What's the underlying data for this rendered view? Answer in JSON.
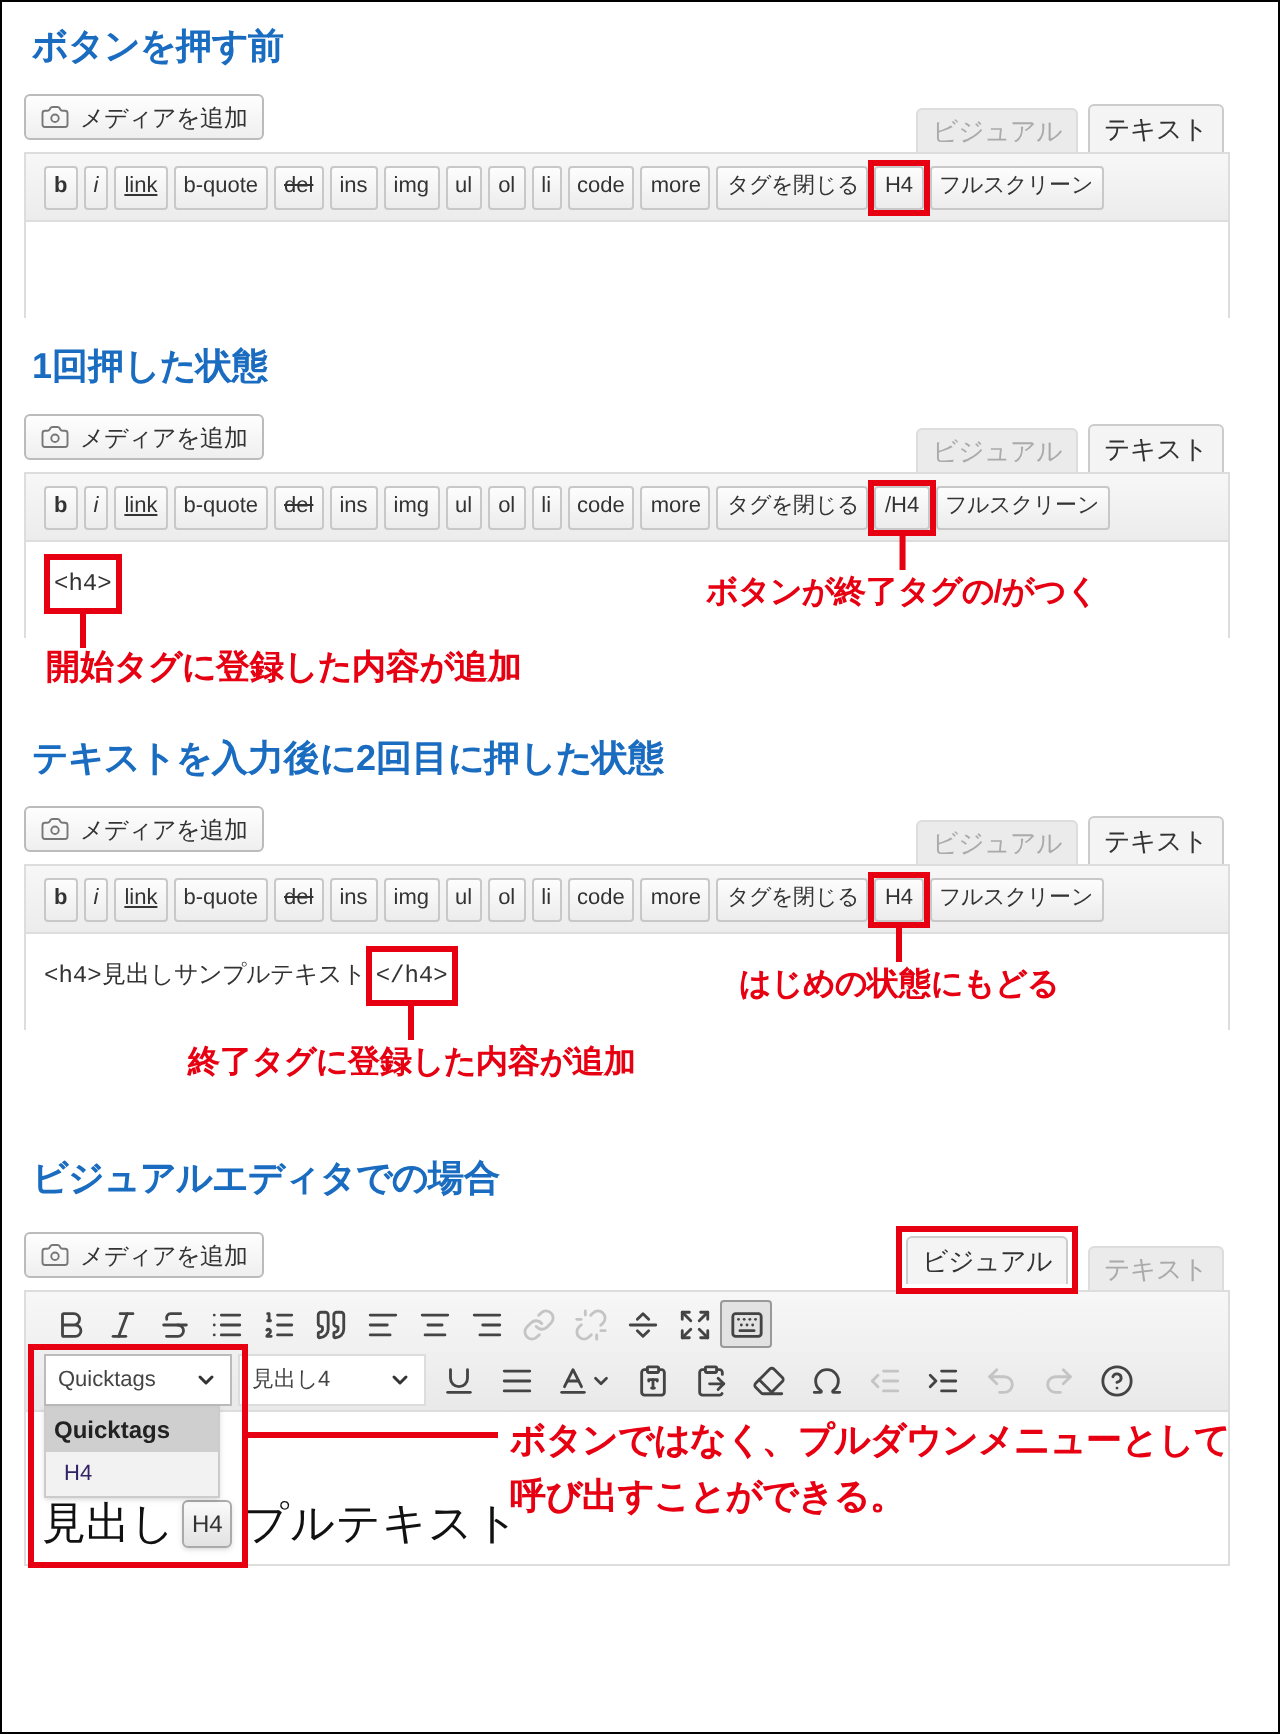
{
  "sections": [
    {
      "kind": "text_editor",
      "heading": "ボタンを押す前",
      "media_button": "メディアを追加",
      "tabs": [
        {
          "label": "ビジュアル",
          "selected": false,
          "highlighted": false
        },
        {
          "label": "テキスト",
          "selected": true,
          "highlighted": false
        }
      ],
      "quicktags": [
        {
          "label": "b",
          "kind": "bold",
          "highlighted": false
        },
        {
          "label": "i",
          "kind": "italic",
          "highlighted": false
        },
        {
          "label": "link",
          "kind": "underline",
          "highlighted": false
        },
        {
          "label": "b-quote",
          "kind": "plain",
          "highlighted": false
        },
        {
          "label": "del",
          "kind": "strike",
          "highlighted": false
        },
        {
          "label": "ins",
          "kind": "plain",
          "highlighted": false
        },
        {
          "label": "img",
          "kind": "plain",
          "highlighted": false
        },
        {
          "label": "ul",
          "kind": "plain",
          "highlighted": false
        },
        {
          "label": "ol",
          "kind": "plain",
          "highlighted": false
        },
        {
          "label": "li",
          "kind": "plain",
          "highlighted": false
        },
        {
          "label": "code",
          "kind": "plain",
          "highlighted": false
        },
        {
          "label": "more",
          "kind": "plain",
          "highlighted": false
        },
        {
          "label": "タグを閉じる",
          "kind": "plain",
          "highlighted": false
        },
        {
          "label": "H4",
          "kind": "plain",
          "highlighted": true
        },
        {
          "label": "フルスクリーン",
          "kind": "plain",
          "highlighted": false
        }
      ]
    },
    {
      "kind": "text_editor",
      "heading": "1回押した状態",
      "media_button": "メディアを追加",
      "tabs": [
        {
          "label": "ビジュアル",
          "selected": false,
          "highlighted": false
        },
        {
          "label": "テキスト",
          "selected": true,
          "highlighted": false
        }
      ],
      "quicktags": [
        {
          "label": "b",
          "kind": "bold",
          "highlighted": false
        },
        {
          "label": "i",
          "kind": "italic",
          "highlighted": false
        },
        {
          "label": "link",
          "kind": "underline",
          "highlighted": false
        },
        {
          "label": "b-quote",
          "kind": "plain",
          "highlighted": false
        },
        {
          "label": "del",
          "kind": "strike",
          "highlighted": false
        },
        {
          "label": "ins",
          "kind": "plain",
          "highlighted": false
        },
        {
          "label": "img",
          "kind": "plain",
          "highlighted": false
        },
        {
          "label": "ul",
          "kind": "plain",
          "highlighted": false
        },
        {
          "label": "ol",
          "kind": "plain",
          "highlighted": false
        },
        {
          "label": "li",
          "kind": "plain",
          "highlighted": false
        },
        {
          "label": "code",
          "kind": "plain",
          "highlighted": false
        },
        {
          "label": "more",
          "kind": "plain",
          "highlighted": false
        },
        {
          "label": "タグを閉じる",
          "kind": "plain",
          "highlighted": false
        },
        {
          "label": "/H4",
          "kind": "plain",
          "highlighted": true,
          "callout": "ボタンが終了タグの/がつく"
        },
        {
          "label": "フルスクリーン",
          "kind": "plain",
          "highlighted": false
        }
      ],
      "content": [
        {
          "text": "<h4>",
          "highlighted": true,
          "callout": "開始タグに登録した内容が追加"
        }
      ]
    },
    {
      "kind": "text_editor",
      "heading": "テキストを入力後に2回目に押した状態",
      "media_button": "メディアを追加",
      "tabs": [
        {
          "label": "ビジュアル",
          "selected": false,
          "highlighted": false
        },
        {
          "label": "テキスト",
          "selected": true,
          "highlighted": false
        }
      ],
      "quicktags": [
        {
          "label": "b",
          "kind": "bold",
          "highlighted": false
        },
        {
          "label": "i",
          "kind": "italic",
          "highlighted": false
        },
        {
          "label": "link",
          "kind": "underline",
          "highlighted": false
        },
        {
          "label": "b-quote",
          "kind": "plain",
          "highlighted": false
        },
        {
          "label": "del",
          "kind": "strike",
          "highlighted": false
        },
        {
          "label": "ins",
          "kind": "plain",
          "highlighted": false
        },
        {
          "label": "img",
          "kind": "plain",
          "highlighted": false
        },
        {
          "label": "ul",
          "kind": "plain",
          "highlighted": false
        },
        {
          "label": "ol",
          "kind": "plain",
          "highlighted": false
        },
        {
          "label": "li",
          "kind": "plain",
          "highlighted": false
        },
        {
          "label": "code",
          "kind": "plain",
          "highlighted": false
        },
        {
          "label": "more",
          "kind": "plain",
          "highlighted": false
        },
        {
          "label": "タグを閉じる",
          "kind": "plain",
          "highlighted": false
        },
        {
          "label": "H4",
          "kind": "plain",
          "highlighted": true,
          "callout": "はじめの状態にもどる"
        },
        {
          "label": "フルスクリーン",
          "kind": "plain",
          "highlighted": false
        }
      ],
      "content": [
        {
          "text": "<h4>見出しサンプルテキスト",
          "highlighted": false
        },
        {
          "text": "</h4>",
          "highlighted": true,
          "callout": "終了タグに登録した内容が追加"
        }
      ]
    },
    {
      "kind": "visual_editor",
      "heading": "ビジュアルエディタでの場合",
      "media_button": "メディアを追加",
      "tabs": [
        {
          "label": "ビジュアル",
          "selected": true,
          "highlighted": true
        },
        {
          "label": "テキスト",
          "selected": false,
          "highlighted": false
        }
      ],
      "toolbar_row_1": [
        {
          "disabled": false,
          "pressed": false
        },
        {
          "disabled": false,
          "pressed": false
        },
        {
          "disabled": false,
          "pressed": false
        },
        {
          "disabled": false,
          "pressed": false
        },
        {
          "disabled": false,
          "pressed": false
        },
        {
          "disabled": false,
          "pressed": false
        },
        {
          "disabled": false,
          "pressed": false
        },
        {
          "disabled": false,
          "pressed": false
        },
        {
          "disabled": false,
          "pressed": false
        },
        {
          "disabled": true,
          "pressed": false
        },
        {
          "disabled": true,
          "pressed": false
        },
        {
          "disabled": false,
          "pressed": false
        },
        {
          "disabled": false,
          "pressed": false
        },
        {
          "disabled": false,
          "pressed": true
        }
      ],
      "toolbar_row_2": [
        {
          "kind": "select",
          "value": "Quicktags",
          "open": true,
          "highlighted": true,
          "menu": [
            {
              "label": "Quicktags",
              "selected": true
            },
            {
              "label": "H4",
              "selected": false
            }
          ]
        },
        {
          "kind": "select",
          "value": "見出し4",
          "open": false,
          "highlighted": false
        },
        {
          "kind": "tool",
          "disabled": false
        },
        {
          "kind": "tool",
          "disabled": false
        },
        {
          "kind": "tool",
          "disabled": false
        },
        {
          "kind": "tool",
          "disabled": false
        },
        {
          "kind": "tool",
          "disabled": false
        },
        {
          "kind": "tool",
          "disabled": false
        },
        {
          "kind": "tool",
          "disabled": false
        },
        {
          "kind": "tool",
          "disabled": true
        },
        {
          "kind": "tool",
          "disabled": false
        },
        {
          "kind": "tool",
          "disabled": true
        },
        {
          "kind": "tool",
          "disabled": true
        },
        {
          "kind": "tool",
          "disabled": false
        }
      ],
      "content_segments": [
        "見出し",
        "プルテキスト"
      ],
      "tooltip": "H4",
      "callout": "ボタンではなく、プルダウンメニューとして呼び出すことができる。"
    }
  ]
}
